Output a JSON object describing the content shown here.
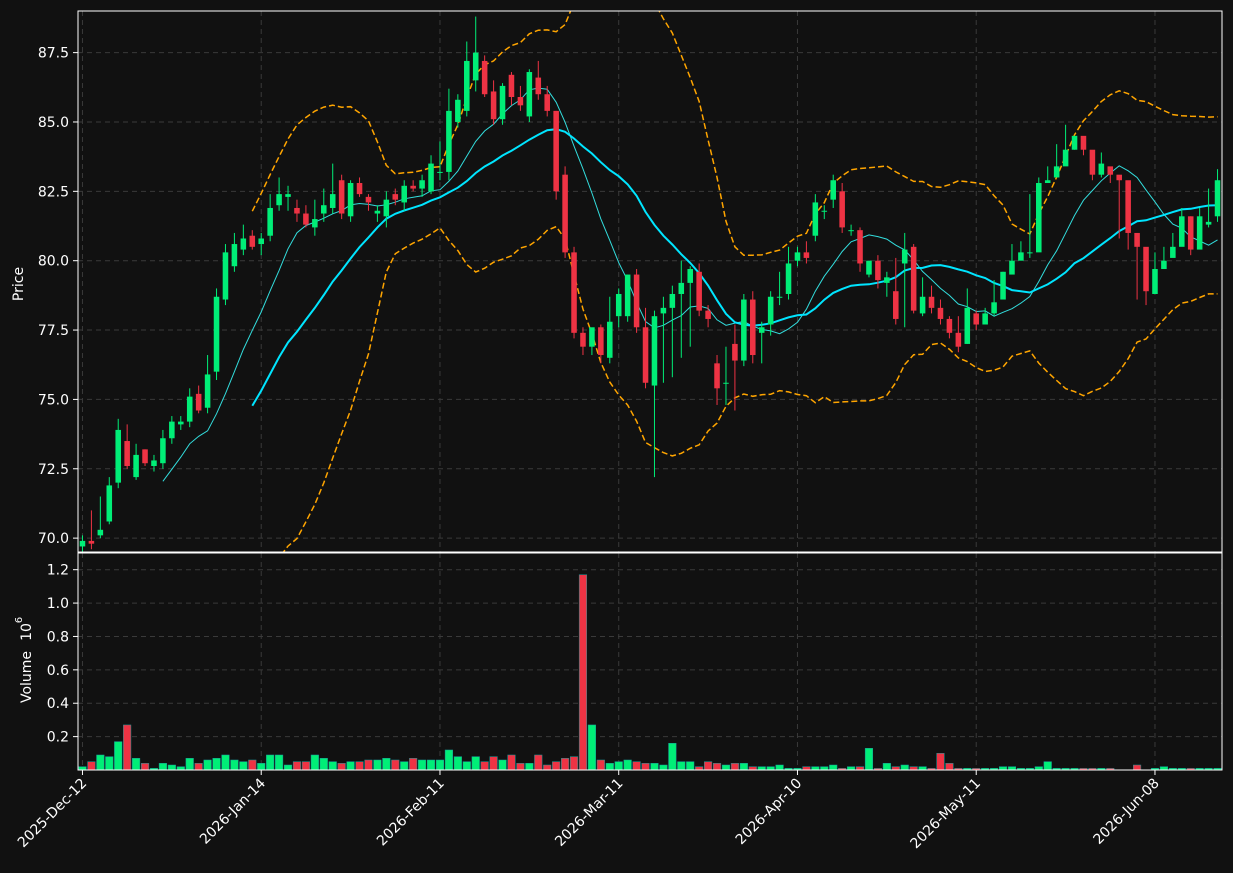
{
  "chart_data": {
    "type": "candlestick",
    "panels": {
      "price": {
        "ylabel": "Price",
        "ylim": [
          69.5,
          89.0
        ],
        "yticks": [
          70.0,
          72.5,
          75.0,
          77.5,
          80.0,
          82.5,
          85.0,
          87.5
        ]
      },
      "volume": {
        "ylabel": "Volume",
        "exponent_label": "10",
        "exponent_power": "6",
        "ylim": [
          0,
          1.3
        ],
        "yticks": [
          0.2,
          0.4,
          0.6,
          0.8,
          1.0,
          1.2
        ],
        "ytick_labels": [
          "0.2",
          "0.4",
          "0.6",
          "0.8",
          "1.0",
          "1.2"
        ]
      }
    },
    "xtick_labels": [
      "2025-Dec-12",
      "2026-Jan-14",
      "2026-Feb-11",
      "2026-Mar-11",
      "2026-Apr-10",
      "2026-May-11",
      "2026-Jun-08"
    ],
    "xtick_indices": [
      0,
      20,
      40,
      60,
      80,
      100,
      120
    ],
    "grid": true,
    "colors": {
      "up": "#00ee77",
      "down": "#ee3344",
      "ma_thin": "#33dddd",
      "ma_thick": "#00e5ff",
      "band": "#ffa500",
      "background": "#111111",
      "grid": "#3a3a3a"
    },
    "close": [
      69.9,
      69.8,
      70.3,
      71.9,
      73.9,
      72.6,
      73.0,
      72.7,
      72.8,
      73.6,
      74.2,
      74.2,
      75.1,
      74.6,
      75.9,
      78.7,
      80.3,
      80.6,
      80.8,
      80.5,
      80.8,
      81.9,
      82.4,
      82.4,
      81.7,
      81.3,
      81.5,
      82.0,
      82.4,
      81.7,
      82.8,
      82.4,
      82.1,
      81.8,
      82.2,
      82.2,
      82.7,
      82.6,
      82.9,
      83.5,
      83.2,
      85.4,
      85.8,
      87.2,
      87.5,
      86.0,
      85.1,
      86.3,
      85.9,
      85.6,
      86.8,
      86.0,
      85.4,
      82.5,
      80.3,
      77.4,
      76.9,
      77.6,
      76.6,
      77.8,
      78.8,
      79.5,
      77.6,
      75.6,
      78.0,
      78.3,
      78.8,
      79.2,
      79.7,
      78.2,
      77.9,
      75.4,
      75.6,
      76.4,
      78.6,
      76.6,
      77.6,
      78.7,
      78.7,
      79.9,
      80.3,
      80.1,
      82.1,
      81.8,
      82.9,
      81.2,
      81.1,
      79.9,
      80.0,
      79.3,
      79.4,
      77.9,
      80.4,
      78.2,
      78.7,
      78.3,
      77.9,
      77.4,
      76.9,
      78.3,
      77.7,
      78.1,
      78.5,
      79.6,
      80.0,
      80.3,
      80.3,
      82.8,
      82.9,
      83.4,
      84.0,
      84.5,
      84.0,
      83.1,
      83.5,
      83.1,
      82.9,
      81.0,
      80.5,
      78.9,
      79.7,
      80.0,
      80.5,
      81.6,
      80.4,
      81.6,
      81.4,
      82.9
    ],
    "open": [
      69.7,
      69.9,
      70.1,
      70.6,
      72.0,
      73.5,
      72.2,
      73.2,
      72.6,
      72.7,
      73.6,
      74.1,
      74.2,
      75.2,
      74.7,
      76.0,
      78.6,
      79.8,
      80.4,
      80.9,
      80.6,
      80.9,
      82.0,
      82.3,
      81.9,
      81.7,
      81.2,
      81.7,
      81.9,
      82.9,
      81.6,
      82.8,
      82.3,
      81.7,
      81.6,
      82.4,
      82.1,
      82.7,
      82.6,
      82.5,
      83.2,
      83.2,
      85.0,
      85.4,
      86.5,
      87.2,
      86.1,
      85.1,
      86.7,
      85.9,
      85.2,
      86.6,
      86.0,
      85.4,
      83.1,
      80.3,
      77.4,
      76.9,
      77.6,
      76.5,
      78.0,
      78.0,
      79.5,
      77.6,
      75.5,
      78.1,
      78.3,
      78.8,
      79.2,
      79.6,
      78.2,
      76.3,
      75.6,
      77.0,
      76.4,
      78.6,
      77.4,
      77.7,
      78.7,
      78.8,
      80.0,
      80.3,
      80.9,
      81.8,
      82.2,
      82.5,
      81.1,
      81.1,
      79.5,
      80.0,
      79.2,
      78.9,
      79.9,
      80.5,
      78.1,
      78.7,
      78.3,
      77.9,
      77.4,
      77.0,
      78.1,
      77.7,
      78.1,
      78.6,
      79.5,
      80.0,
      80.3,
      80.3,
      82.8,
      83.0,
      83.4,
      84.0,
      84.5,
      84.0,
      83.1,
      83.4,
      83.1,
      82.9,
      81.0,
      80.5,
      78.8,
      79.7,
      80.1,
      80.5,
      81.6,
      80.4,
      81.3,
      81.6
    ],
    "high": [
      70.1,
      71.0,
      71.5,
      72.2,
      74.3,
      74.1,
      73.4,
      73.2,
      73.0,
      73.9,
      74.4,
      74.4,
      75.4,
      75.5,
      76.6,
      79.0,
      80.6,
      81.0,
      81.3,
      81.1,
      81.0,
      82.4,
      83.0,
      82.7,
      82.2,
      82.0,
      82.2,
      82.6,
      83.5,
      83.1,
      82.9,
      83.0,
      82.4,
      82.0,
      82.5,
      82.6,
      82.9,
      82.9,
      83.1,
      83.8,
      84.3,
      86.2,
      86.0,
      87.9,
      88.8,
      87.4,
      86.5,
      86.4,
      86.8,
      86.3,
      86.9,
      87.2,
      86.3,
      85.4,
      83.4,
      80.5,
      77.6,
      77.4,
      77.7,
      78.7,
      79.0,
      79.5,
      79.7,
      78.3,
      78.2,
      78.7,
      79.1,
      80.0,
      79.8,
      79.9,
      78.4,
      76.6,
      76.9,
      77.7,
      78.8,
      78.9,
      77.8,
      78.9,
      79.6,
      80.5,
      80.5,
      80.7,
      82.4,
      82.0,
      83.1,
      82.8,
      81.3,
      81.2,
      80.0,
      80.2,
      79.6,
      80.1,
      81.0,
      80.6,
      79.4,
      79.1,
      78.6,
      78.0,
      78.0,
      79.0,
      78.2,
      78.3,
      79.3,
      79.6,
      80.6,
      80.7,
      82.4,
      83.0,
      83.4,
      84.2,
      84.9,
      84.5,
      84.3,
      83.9,
      83.9,
      83.3,
      83.0,
      81.4,
      80.6,
      79.1,
      80.3,
      80.5,
      81.0,
      81.9,
      81.6,
      81.9,
      82.6,
      83.3
    ],
    "low": [
      69.5,
      69.6,
      70.0,
      70.5,
      71.8,
      72.5,
      72.1,
      72.6,
      72.4,
      72.5,
      73.4,
      73.9,
      74.0,
      74.5,
      74.5,
      75.7,
      78.4,
      79.6,
      80.2,
      80.4,
      80.2,
      80.7,
      81.8,
      81.8,
      81.4,
      81.2,
      80.9,
      81.4,
      81.7,
      81.5,
      81.4,
      82.3,
      81.8,
      81.4,
      81.2,
      82.0,
      81.8,
      82.5,
      82.3,
      82.4,
      82.9,
      82.9,
      84.8,
      85.2,
      86.1,
      85.9,
      84.9,
      84.9,
      85.6,
      85.4,
      85.0,
      85.8,
      85.2,
      82.2,
      80.1,
      77.2,
      76.6,
      76.6,
      76.3,
      76.3,
      77.6,
      77.8,
      77.4,
      75.4,
      72.2,
      75.6,
      75.8,
      76.5,
      76.9,
      78.0,
      77.6,
      74.8,
      74.8,
      74.6,
      76.2,
      76.3,
      76.3,
      77.3,
      78.4,
      78.6,
      79.8,
      79.9,
      80.7,
      81.5,
      81.9,
      81.0,
      80.9,
      79.6,
      79.4,
      79.0,
      78.7,
      77.7,
      77.6,
      78.1,
      78.0,
      78.1,
      77.7,
      77.2,
      76.7,
      77.0,
      77.5,
      77.7,
      78.0,
      79.3,
      79.9,
      80.1,
      80.1,
      82.6,
      82.8,
      83.2,
      83.8,
      84.0,
      83.8,
      82.9,
      83.0,
      82.8,
      80.8,
      80.4,
      78.6,
      78.4,
      79.4,
      79.8,
      80.2,
      81.2,
      80.2,
      81.2,
      81.2,
      81.4
    ],
    "volume": [
      0.02,
      0.05,
      0.09,
      0.08,
      0.17,
      0.27,
      0.07,
      0.04,
      0.01,
      0.04,
      0.03,
      0.02,
      0.07,
      0.04,
      0.06,
      0.07,
      0.09,
      0.06,
      0.05,
      0.06,
      0.04,
      0.09,
      0.09,
      0.03,
      0.05,
      0.05,
      0.09,
      0.07,
      0.05,
      0.04,
      0.05,
      0.05,
      0.06,
      0.06,
      0.07,
      0.06,
      0.05,
      0.07,
      0.06,
      0.06,
      0.06,
      0.12,
      0.08,
      0.05,
      0.08,
      0.05,
      0.08,
      0.06,
      0.09,
      0.04,
      0.04,
      0.09,
      0.03,
      0.05,
      0.07,
      0.08,
      1.17,
      0.27,
      0.06,
      0.04,
      0.05,
      0.06,
      0.05,
      0.04,
      0.04,
      0.03,
      0.16,
      0.05,
      0.05,
      0.02,
      0.05,
      0.04,
      0.03,
      0.04,
      0.04,
      0.02,
      0.02,
      0.02,
      0.03,
      0.01,
      0.01,
      0.02,
      0.02,
      0.02,
      0.03,
      0.01,
      0.02,
      0.02,
      0.13,
      0.01,
      0.04,
      0.02,
      0.03,
      0.02,
      0.02,
      0.01,
      0.1,
      0.04,
      0.01,
      0.01,
      0.01,
      0.01,
      0.01,
      0.02,
      0.02,
      0.01,
      0.01,
      0.02,
      0.05,
      0.01,
      0.01,
      0.01,
      0.01,
      0.01,
      0.01,
      0.01,
      0.0,
      0.0,
      0.03,
      0.0,
      0.01,
      0.02,
      0.01,
      0.01,
      0.01,
      0.01,
      0.01,
      0.01,
      0.01,
      0.01
    ]
  }
}
